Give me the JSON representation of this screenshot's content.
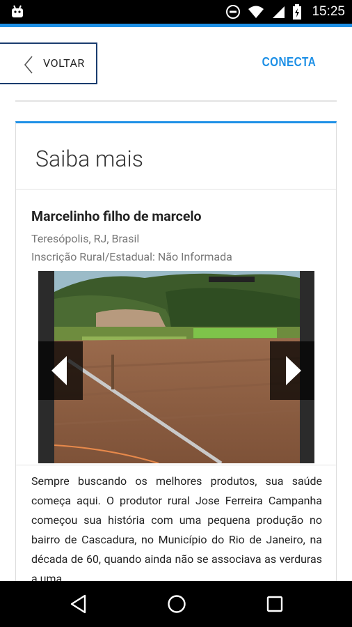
{
  "status_bar": {
    "time": "15:25",
    "icons": [
      "android-icon",
      "dnd-icon",
      "wifi-icon",
      "signal-icon",
      "battery-charging-icon"
    ]
  },
  "header": {
    "back_label": "VOLTAR",
    "brand_label": "CONECTA"
  },
  "card": {
    "title": "Saiba mais",
    "farm_name": "Marcelinho filho de marcelo",
    "location": "Teresópolis, RJ, Brasil",
    "registration": "Inscrição Rural/Estadual: Não Informada",
    "description": "Sempre buscando os melhores produtos, sua saúde começa aqui. O produtor rural Jose Ferreira Campanha começou sua história com uma pequena produção no bairro de Cascadura, no Município do Rio de Janeiro, na década de 60, quando ainda não se associava as verduras a uma"
  },
  "colors": {
    "accent": "#1e90e6",
    "back_border": "#1a3c6e"
  },
  "nav_bar": {
    "icons": [
      "back-triangle-icon",
      "home-circle-icon",
      "recents-square-icon"
    ]
  }
}
